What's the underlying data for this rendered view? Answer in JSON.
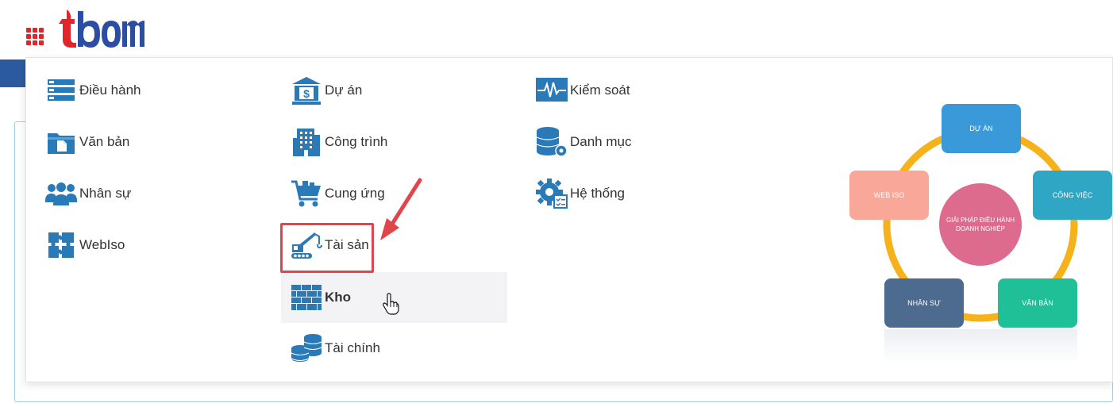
{
  "colors": {
    "icon_blue": "#2a7ab8",
    "accent_red": "#e2444b",
    "ring_yellow": "#f6b21b"
  },
  "header": {
    "apps_icon": "grid-icon",
    "logo_text": "tbom"
  },
  "menu": {
    "col1": [
      {
        "label": "Điều hành",
        "icon": "list-icon"
      },
      {
        "label": "Văn bản",
        "icon": "folder-document-icon"
      },
      {
        "label": "Nhân sự",
        "icon": "users-group-icon"
      },
      {
        "label": "WebIso",
        "icon": "puzzle-icon"
      }
    ],
    "col2": [
      {
        "label": "Dự án",
        "icon": "bank-dollar-icon"
      },
      {
        "label": "Công trình",
        "icon": "building-icon"
      },
      {
        "label": "Cung ứng",
        "icon": "cart-icon"
      },
      {
        "label": "Tài sản",
        "icon": "crane-icon"
      },
      {
        "label": "Kho",
        "icon": "brick-wall-icon"
      },
      {
        "label": "Tài chính",
        "icon": "coin-stack-icon"
      }
    ],
    "col3": [
      {
        "label": "Kiểm soát",
        "icon": "pulse-monitor-icon"
      },
      {
        "label": "Danh mục",
        "icon": "database-gear-icon"
      },
      {
        "label": "Hệ thống",
        "icon": "gear-checklist-icon"
      }
    ]
  },
  "diagram": {
    "center": "GIẢI PHÁP ĐIỀU HÀNH DOANH NGHIỆP",
    "nodes": {
      "du_an": {
        "label": "DỰ ÁN",
        "color": "#3a9ad9"
      },
      "cong_viec": {
        "label": "CÔNG VIỆC",
        "color": "#2ea6c4"
      },
      "van_ban": {
        "label": "VĂN BẢN",
        "color": "#1fbf98"
      },
      "nhan_su": {
        "label": "NHÂN SỰ",
        "color": "#4d6a8f"
      },
      "web_iso": {
        "label": "WEB ISO",
        "color": "#f8a799"
      }
    }
  }
}
